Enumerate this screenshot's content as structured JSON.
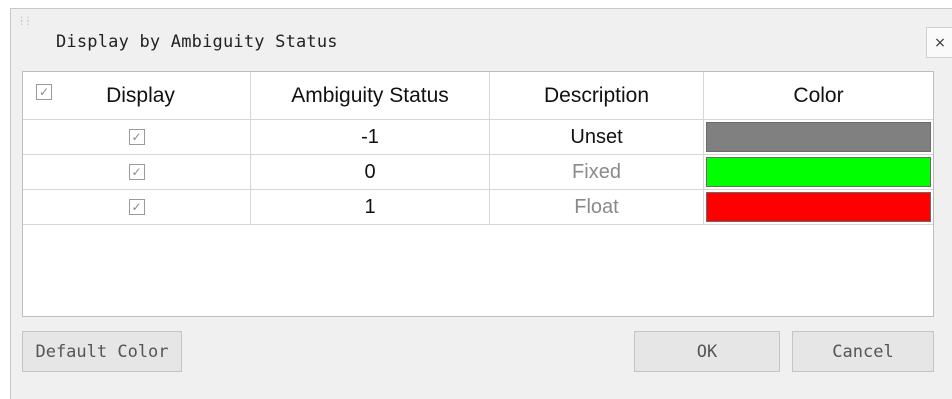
{
  "dialog": {
    "title": "Display by Ambiguity Status",
    "close_label": "×"
  },
  "table": {
    "columns": [
      "Display",
      "Ambiguity Status",
      "Description",
      "Color"
    ],
    "header_checked": true,
    "rows": [
      {
        "checked": true,
        "status": "-1",
        "description": "Unset",
        "color": "#808080"
      },
      {
        "checked": true,
        "status": "0",
        "description": "Fixed",
        "color": "#00ff00"
      },
      {
        "checked": true,
        "status": "1",
        "description": "Float",
        "color": "#ff0000"
      }
    ],
    "check_glyph": "✓"
  },
  "buttons": {
    "default_color": "Default Color",
    "ok": "OK",
    "cancel": "Cancel"
  }
}
